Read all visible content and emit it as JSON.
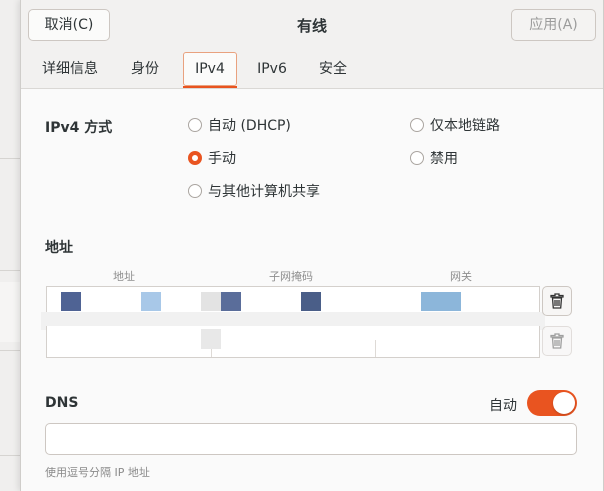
{
  "header": {
    "cancel_label": "取消(C)",
    "title": "有线",
    "apply_label": "应用(A)"
  },
  "tabs": [
    {
      "label": "详细信息"
    },
    {
      "label": "身份"
    },
    {
      "label": "IPv4",
      "active": true
    },
    {
      "label": "IPv6"
    },
    {
      "label": "安全"
    }
  ],
  "ipv4_method": {
    "label": "IPv4 方式",
    "options": [
      {
        "label": "自动 (DHCP)",
        "checked": false
      },
      {
        "label": "仅本地链路",
        "checked": false
      },
      {
        "label": "手动",
        "checked": true
      },
      {
        "label": "禁用",
        "checked": false
      },
      {
        "label": "与其他计算机共享",
        "checked": false
      }
    ]
  },
  "addresses": {
    "label": "地址",
    "columns": [
      "地址",
      "子网掩码",
      "网关"
    ]
  },
  "dns": {
    "label": "DNS",
    "auto_label": "自动",
    "auto_enabled": true,
    "value": "",
    "hint": "使用逗号分隔 IP 地址"
  },
  "colors": {
    "accent": "#e95420"
  },
  "icons": {
    "delete": "trash-icon"
  }
}
